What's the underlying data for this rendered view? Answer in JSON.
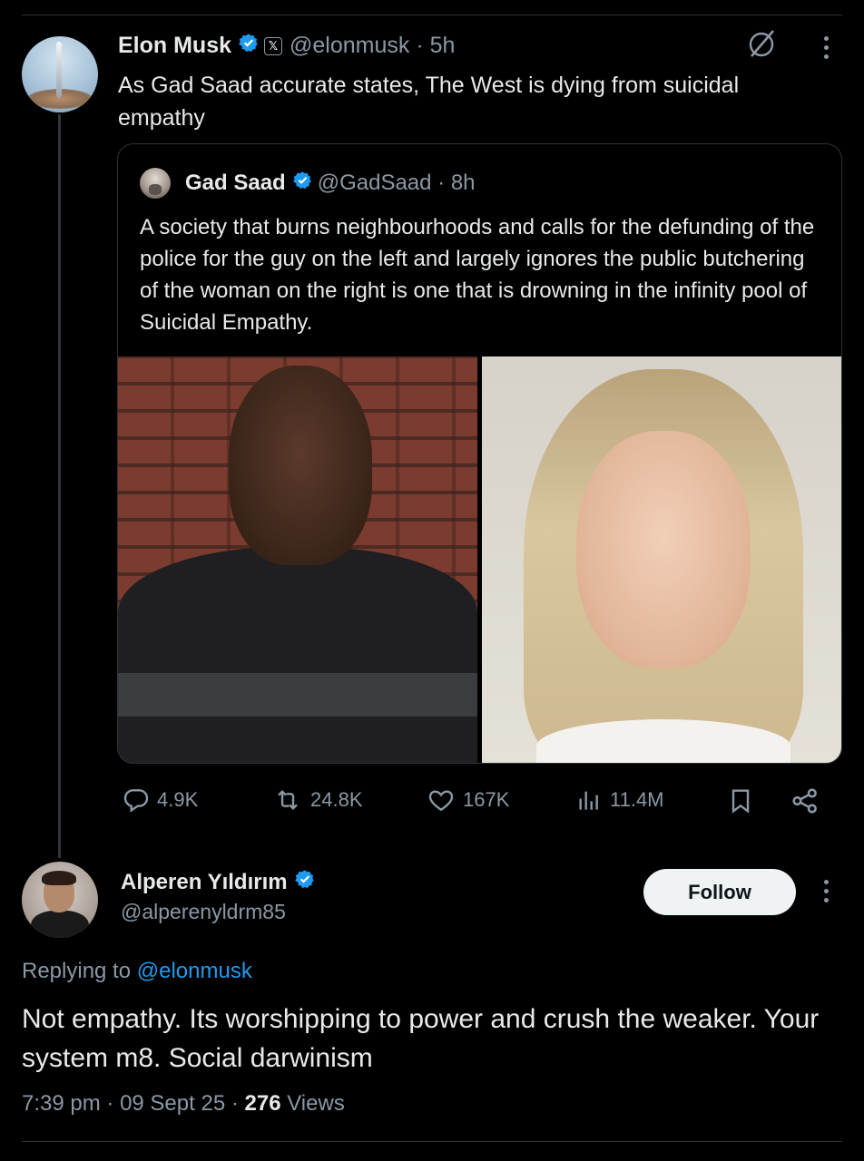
{
  "main_post": {
    "author_name": "Elon Musk",
    "handle": "@elonmusk",
    "time": "5h",
    "text": "As Gad Saad accurate states, The West is dying from suicidal empathy",
    "icons": {
      "verified": "verified-badge-icon",
      "affiliate": "x-affiliate-icon",
      "grok": "grok-icon",
      "more": "more-icon"
    }
  },
  "quoted_post": {
    "author_name": "Gad Saad",
    "handle": "@GadSaad",
    "time": "8h",
    "text": "A society that burns neighbourhoods and calls for the defunding of the police for the guy on the left and largely ignores the public butchering of the woman on the right is one that is drowning in the infinity pool of Suicidal Empathy."
  },
  "actions": {
    "replies": "4.9K",
    "reposts": "24.8K",
    "likes": "167K",
    "views": "11.4M"
  },
  "reply": {
    "author_name": "Alperen Yıldırım",
    "handle": "@alperenyldrm85",
    "follow_label": "Follow",
    "replying_prefix": "Replying to",
    "replying_mention": "@elonmusk",
    "text": "Not empathy. Its worshipping to power and crush the weaker. Your system m8. Social darwinism",
    "time": "7:39 pm",
    "date": "09 Sept 25",
    "views_count": "276",
    "views_label": "Views"
  },
  "colors": {
    "background": "#000000",
    "text": "#e7e9ea",
    "muted": "#8b98a5",
    "accent": "#1d9bf0",
    "border": "#2f3336"
  }
}
